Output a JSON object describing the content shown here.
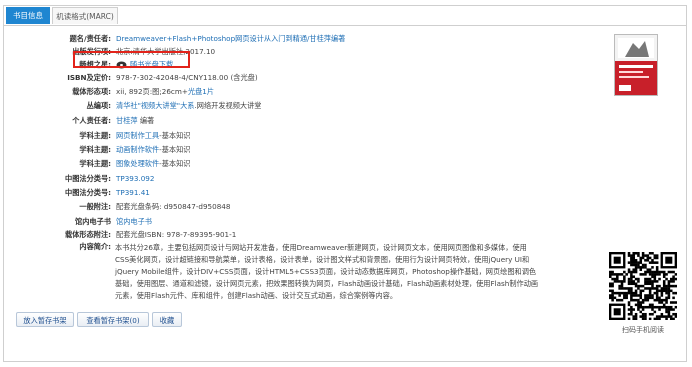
{
  "tabs": [
    {
      "label": "书目信息"
    },
    {
      "label": "机读格式(MARC)"
    }
  ],
  "fields": {
    "title_resp": {
      "label": "题名/责任者:",
      "value": "Dreamweaver+Flash+Photoshop网页设计从入门到精通/甘桂萍编著"
    },
    "publication": {
      "label": "出版发行项:",
      "value": "北京:清华大学出版社,2017.10"
    },
    "hongxiang": {
      "label": "畅想之星:",
      "value": "随书光盘下载"
    },
    "isbn": {
      "label": "ISBN及定价:",
      "value": "978-7-302-42048-4/CNY118.00 (含光盘)"
    },
    "physical": {
      "label": "载体形态项:",
      "value_prefix": "xii, 892页:图;26cm+",
      "value_link": "光盘1片"
    },
    "series": {
      "label": "丛编项:",
      "value_link": "清华社\"视频大讲堂\"大系",
      "value_suffix": ".网络开发视频大讲堂"
    },
    "author": {
      "label": "个人责任者:",
      "value_link": "甘桂萍",
      "value_suffix": " 编著"
    },
    "subjects": [
      {
        "label": "学科主题:",
        "value_link": "网页制作工具",
        "value_suffix": "-基本知识"
      },
      {
        "label": "学科主题:",
        "value_link": "动画制作软件",
        "value_suffix": "-基本知识"
      },
      {
        "label": "学科主题:",
        "value_link": "图象处理软件",
        "value_suffix": "-基本知识"
      }
    ],
    "clc": [
      {
        "label": "中图法分类号:",
        "value": "TP393.092"
      },
      {
        "label": "中图法分类号:",
        "value": "TP391.41"
      }
    ],
    "general_note": {
      "label": "一般附注:",
      "value": "配套光盘条码: d950847-d950848"
    },
    "ebook": {
      "label": "馆内电子书",
      "value": "馆内电子书"
    },
    "carrier_note": {
      "label": "载体形态附注:",
      "value": "配套光盘ISBN: 978-7-89395-901-1"
    },
    "summary": {
      "label": "内容简介:",
      "value": "本书共分26章，主要包括网页设计与网站开发准备，使用Dreamweaver新建网页，设计网页文本，使用网页图像和多媒体，使用CSS美化网页，设计超链接和导航菜单，设计表格，设计表单，设计图文样式和背景图，使用行为设计网页特效，使用jQuery UI和jQuery Mobile组件，设计DIV+CSS页面，设计HTML5+CSS3页面，设计动态数据库网页，Photoshop操作基础，网页绘图和调色基础，使用图层、通道和滤镜，设计网页元素，把效果图转换为网页，Flash动画设计基础，Flash动画素材处理，使用Flash制作动画元素，使用Flash元件、库和组件，创建Flash动画、设计交互式动画，综合案例等内容。"
    }
  },
  "buttons": {
    "add_cart": "放入暂存书架",
    "view_cart": "查看暂存书架(0)",
    "favorite": "收藏"
  },
  "qr_caption": "扫码手机阅读",
  "colors": {
    "accent": "#1f86d1",
    "link": "#1f6fb5",
    "highlight": "#e2231a"
  }
}
